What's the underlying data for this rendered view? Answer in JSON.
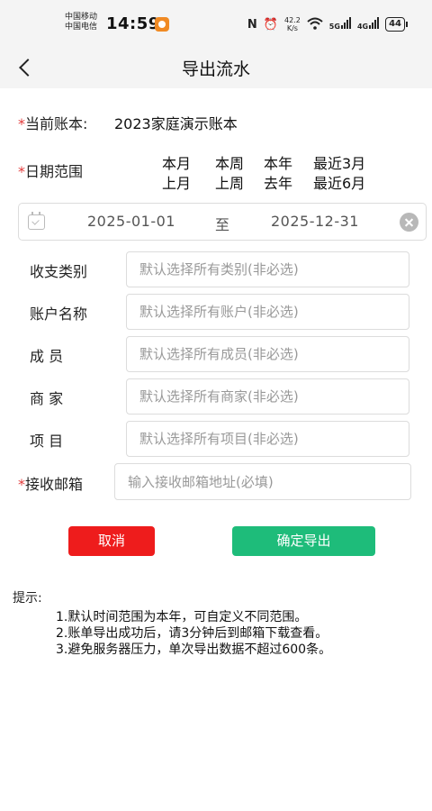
{
  "status_bar": {
    "carrier_1": "中国移动",
    "carrier_2": "中国电信",
    "time": "14:59",
    "nfc": "N",
    "alarm": "⏰",
    "net_speed_value": "42.2",
    "net_speed_unit": "K/s",
    "wifi": "",
    "signal_1": "5G",
    "signal_2": "4G",
    "battery": "44"
  },
  "nav": {
    "back_icon": "chevron-left-icon",
    "title": "导出流水"
  },
  "form": {
    "required_mark": "*",
    "ledger_label": "当前账本:",
    "ledger_value": "2023家庭演示账本",
    "date_label": "日期范围",
    "date_quick_row_1": [
      "本月",
      "本周",
      "本年",
      "最近3月"
    ],
    "date_quick_row_2": [
      "上月",
      "上周",
      "去年",
      "最近6月"
    ],
    "date_start": "2025-01-01",
    "date_sep": "至",
    "date_end": "2025-12-31",
    "category_label": "收支类别",
    "category_placeholder": "默认选择所有类别(非必选)",
    "account_label": "账户名称",
    "account_placeholder": "默认选择所有账户(非必选)",
    "member_label": "成 员",
    "member_placeholder": "默认选择所有成员(非必选)",
    "merchant_label": "商 家",
    "merchant_placeholder": "默认选择所有商家(非必选)",
    "project_label": "项 目",
    "project_placeholder": "默认选择所有项目(非必选)",
    "email_label": "接收邮箱",
    "email_placeholder": "输入接收邮箱地址(必填)"
  },
  "actions": {
    "cancel": "取消",
    "confirm": "确定导出"
  },
  "tips": {
    "title": "提示:",
    "items": [
      "1.默认时间范围为本年，可自定义不同范围。",
      "2.账单导出成功后，请3分钟后到邮箱下载查看。",
      "3.避免服务器压力，单次导出数据不超过600条。"
    ]
  },
  "colors": {
    "required": "#e23b3b",
    "cancel_button": "#ee1c1c",
    "confirm_button": "#1ebc7a",
    "header_bg": "#f4f4f4"
  }
}
